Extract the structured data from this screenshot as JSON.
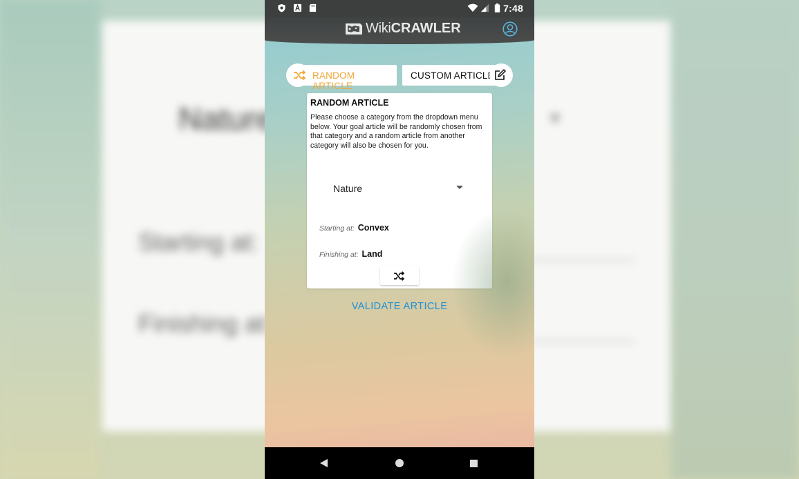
{
  "status_bar": {
    "time": "7:48"
  },
  "app_bar": {
    "brand_wiki": "Wiki",
    "brand_crawler": "CRAWLER"
  },
  "tabs": {
    "random_label": "RANDOM ARTICLE",
    "custom_label": "CUSTOM ARTICLE"
  },
  "card": {
    "title": "RANDOM ARTICLE",
    "description": "Please choose a category from the dropdown menu below. Your goal article will be randomly chosen from that category and a random article from another category will also be chosen for you.",
    "category_selected": "Nature",
    "starting_label": "Starting at:",
    "starting_value": "Convex",
    "finishing_label": "Finishing at:",
    "finishing_value": "Land"
  },
  "validate_label": "VALIDATE ARTICLE",
  "colors": {
    "accent_orange": "#f0a73a",
    "link_blue": "#1f8fd6",
    "appbar": "#3f4242"
  },
  "icons": [
    "shield-icon",
    "a-icon",
    "sd-card-icon",
    "wifi-icon",
    "signal-icon",
    "battery-icon",
    "logo-icon",
    "profile-icon",
    "shuffle-icon",
    "edit-icon",
    "back-icon",
    "home-icon",
    "recents-icon"
  ]
}
